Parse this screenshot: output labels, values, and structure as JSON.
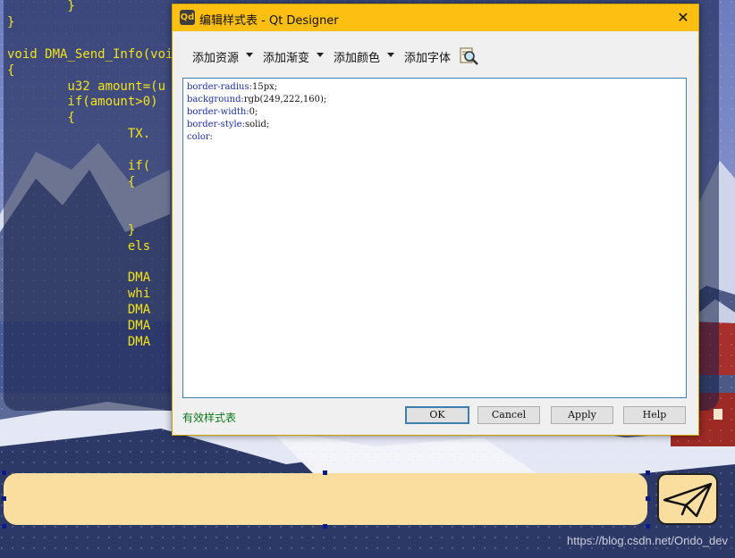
{
  "background": {
    "code_lines": [
      "        }",
      "}",
      "",
      "void DMA_Send_Info(void",
      "{",
      "        u32 amount=(u",
      "        if(amount>0)",
      "        {",
      "                TX.",
      "",
      "                if(",
      "                {",
      "",
      "",
      "                }",
      "                els",
      "",
      "                DMA",
      "                whi",
      "                DMA",
      "                DMA",
      "                DMA"
    ],
    "code_color": "#f4e31a",
    "input_color": "rgb(249,222,160)",
    "watermark": "https://blog.csdn.net/Ondo_dev"
  },
  "dialog": {
    "title": "编辑样式表 - Qt Designer",
    "app_icon_label": "Qd",
    "close_label": "✕",
    "toolbar": {
      "add_resource": "添加资源",
      "add_gradient": "添加渐变",
      "add_color": "添加颜色",
      "add_font": "添加字体"
    },
    "editor_lines": [
      {
        "prop": "border-radius",
        "val": "15px;"
      },
      {
        "prop": "background",
        "val": "rgb(249,222,160);"
      },
      {
        "prop": "border-width",
        "val": "0;"
      },
      {
        "prop": "border-style",
        "val": "solid;"
      },
      {
        "prop": "color",
        "val": ""
      }
    ],
    "status": "有效样式表",
    "buttons": {
      "ok": "OK",
      "cancel": "Cancel",
      "apply": "Apply",
      "help": "Help"
    }
  }
}
